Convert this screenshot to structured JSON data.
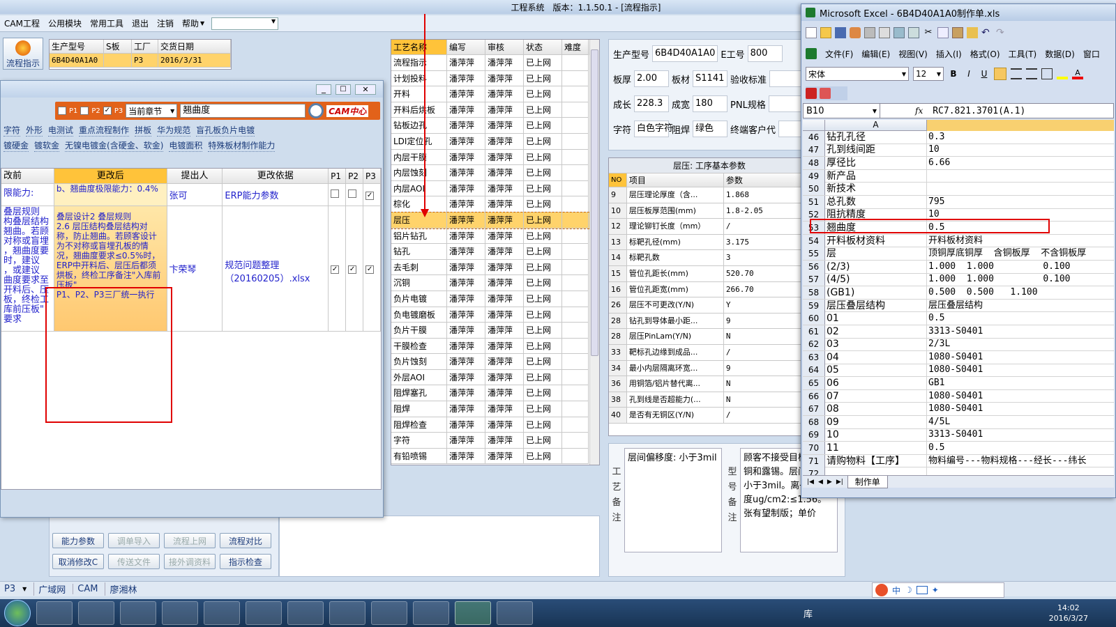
{
  "app": {
    "title": "工程系统　版本：1.1.50.1 - [流程指示]",
    "menu": [
      "CAM工程",
      "公用模块",
      "常用工具",
      "退出",
      "注销",
      "帮助"
    ],
    "process_btn": "流程指示"
  },
  "order": {
    "headers": [
      "生产型号",
      "S板",
      "工厂",
      "交货日期"
    ],
    "row": [
      "6B4D40A1A0",
      "",
      "P3",
      "2016/3/31"
    ]
  },
  "change": {
    "filters": {
      "p1": "P1",
      "p2": "P2",
      "p3": "P3",
      "chapter": "当前章节",
      "search": "翘曲度",
      "logo": "CAM中心"
    },
    "tags1": [
      "字符",
      "外形",
      "电测试",
      "重点流程制作",
      "拼板",
      "华为规范",
      "盲孔板负片电镀"
    ],
    "tags2": [
      "镀硬金",
      "镀软金",
      "无镍电镀金(含硬金、软金)",
      "电镀面积",
      "特殊板材制作能力"
    ],
    "headers": [
      "改前",
      "更改后",
      "提出人",
      "更改依据",
      "P1",
      "P2",
      "P3"
    ],
    "rows": [
      {
        "before": "限能力:",
        "after": "b、翘曲度极限能力：0.4%",
        "by": "张可",
        "basis": "ERP能力参数",
        "p1": "",
        "p2": "",
        "p3": "✓"
      },
      {
        "before": "叠层规则\n构叠层结构\n翘曲。若顾\n对称或盲埋\n，翘曲度要\n时，建议\n，或建议\n曲度要求至\n开料后、压\n板，终检工\n库前压板\"\n要求",
        "after": "叠层设计2 叠层规则\n2.6 层压结构叠层结构对称，防止翘曲。若顾客设计为不对称或盲埋孔板的情况，翘曲度要求≤0.5%时，ERP中开料后、层压后都须烘板，终检工序备注\"入库前压板\"\nP1、P2、P3三厂统一执行",
        "by": "卞荣琴",
        "basis": "规范问题整理（20160205）.xlsx",
        "p1": "✓",
        "p2": "✓",
        "p3": "✓"
      }
    ]
  },
  "buttons": [
    [
      "能力参数",
      "调单导入",
      "流程上网",
      "流程对比"
    ],
    [
      "取消修改C",
      "传送文件",
      "接外调资料",
      "指示检查"
    ]
  ],
  "process": {
    "headers": [
      "工艺名称",
      "编写",
      "审核",
      "状态",
      "难度"
    ],
    "rows": [
      [
        "流程指示",
        "潘萍萍",
        "潘萍萍",
        "已上网"
      ],
      [
        "计划投料",
        "潘萍萍",
        "潘萍萍",
        "已上网"
      ],
      [
        "开料",
        "潘萍萍",
        "潘萍萍",
        "已上网"
      ],
      [
        "开料后烘板",
        "潘萍萍",
        "潘萍萍",
        "已上网"
      ],
      [
        "钻板边孔",
        "潘萍萍",
        "潘萍萍",
        "已上网"
      ],
      [
        "LDI定位孔",
        "潘萍萍",
        "潘萍萍",
        "已上网"
      ],
      [
        "内层干膜",
        "潘萍萍",
        "潘萍萍",
        "已上网"
      ],
      [
        "内层蚀刻",
        "潘萍萍",
        "潘萍萍",
        "已上网"
      ],
      [
        "内层AOI",
        "潘萍萍",
        "潘萍萍",
        "已上网"
      ],
      [
        "棕化",
        "潘萍萍",
        "潘萍萍",
        "已上网"
      ],
      [
        "层压",
        "潘萍萍",
        "潘萍萍",
        "已上网"
      ],
      [
        "铝片钻孔",
        "潘萍萍",
        "潘萍萍",
        "已上网"
      ],
      [
        "钻孔",
        "潘萍萍",
        "潘萍萍",
        "已上网"
      ],
      [
        "去毛刺",
        "潘萍萍",
        "潘萍萍",
        "已上网"
      ],
      [
        "沉铜",
        "潘萍萍",
        "潘萍萍",
        "已上网"
      ],
      [
        "负片电镀",
        "潘萍萍",
        "潘萍萍",
        "已上网"
      ],
      [
        "负电镀磨板",
        "潘萍萍",
        "潘萍萍",
        "已上网"
      ],
      [
        "负片干膜",
        "潘萍萍",
        "潘萍萍",
        "已上网"
      ],
      [
        "干膜检查",
        "潘萍萍",
        "潘萍萍",
        "已上网"
      ],
      [
        "负片蚀刻",
        "潘萍萍",
        "潘萍萍",
        "已上网"
      ],
      [
        "外层AOI",
        "潘萍萍",
        "潘萍萍",
        "已上网"
      ],
      [
        "阻焊塞孔",
        "潘萍萍",
        "潘萍萍",
        "已上网"
      ],
      [
        "阻焊",
        "潘萍萍",
        "潘萍萍",
        "已上网"
      ],
      [
        "阻焊检查",
        "潘萍萍",
        "潘萍萍",
        "已上网"
      ],
      [
        "字符",
        "潘萍萍",
        "潘萍萍",
        "已上网"
      ],
      [
        "有铅喷锡",
        "潘萍萍",
        "潘萍萍",
        "已上网"
      ]
    ]
  },
  "info": {
    "rows": [
      [
        [
          "生产型号",
          "6B4D40A1A0"
        ],
        [
          "E工号",
          "800"
        ]
      ],
      [
        [
          "板厚",
          "2.00"
        ],
        [
          "板材",
          "S1141"
        ],
        [
          "验收标准",
          ""
        ]
      ],
      [
        [
          "成长",
          "228.3"
        ],
        [
          "成宽",
          "180"
        ],
        [
          "PNL规格",
          ""
        ]
      ],
      [
        [
          "字符",
          "白色字符"
        ],
        [
          "阻焊",
          "绿色"
        ],
        [
          "终端客户代",
          ""
        ]
      ]
    ]
  },
  "params": {
    "title": "层压: 工序基本参数",
    "headers": [
      "NO",
      "项目",
      "参数"
    ],
    "rows": [
      [
        "9",
        "层压理论厚度（含...",
        "1.868"
      ],
      [
        "10",
        "层压板厚范围(mm)",
        "1.8-2.05"
      ],
      [
        "12",
        "理论铆钉长度（mm）",
        "/"
      ],
      [
        "13",
        "标靶孔径(mm)",
        "3.175"
      ],
      [
        "14",
        "标靶孔数",
        "3"
      ],
      [
        "15",
        "管位孔距长(mm)",
        "520.70"
      ],
      [
        "16",
        "管位孔距宽(mm)",
        "266.70"
      ],
      [
        "26",
        "层压不可更改(Y/N)",
        "Y"
      ],
      [
        "28",
        "钻孔到导体最小距...",
        "9"
      ],
      [
        "28",
        "层压PinLam(Y/N)",
        "N"
      ],
      [
        "33",
        "靶标孔边缘到成品...",
        "/"
      ],
      [
        "34",
        "最小内层隔离环宽...",
        "9"
      ],
      [
        "36",
        "用铜箔/铝片替代离...",
        "N"
      ],
      [
        "38",
        "孔到线是否超能力(...",
        "N"
      ],
      [
        "40",
        "是否有无铜区(Y/N)",
        "/"
      ]
    ]
  },
  "notes": {
    "process_label": "工艺备注",
    "process_text": "层间偏移度: 小于3mil",
    "model_label": "型号备注",
    "model_text": "顾客不接受目检假性露铜和露锡。层间偏移度小于3mil。离子污染度ug/cm2:≤1.56。张有望制版；单价"
  },
  "excel": {
    "title": "Microsoft Excel - 6B4D40A1A0制作单.xls",
    "menu": [
      "文件(F)",
      "编辑(E)",
      "视图(V)",
      "插入(I)",
      "格式(O)",
      "工具(T)",
      "数据(D)",
      "窗口"
    ],
    "font": "宋体",
    "size": "12",
    "cellref": "B10",
    "fx": "fx",
    "formula": "RC7.821.3701(A.1)",
    "colA": "A",
    "sheet": "制作单",
    "rows": [
      [
        "46",
        "钻孔孔径",
        "0.3"
      ],
      [
        "47",
        "孔到线间距",
        "10"
      ],
      [
        "48",
        "厚径比",
        "6.66"
      ],
      [
        "49",
        "新产品",
        ""
      ],
      [
        "50",
        "新技术",
        ""
      ],
      [
        "51",
        "总孔数",
        "795"
      ],
      [
        "52",
        "阻抗精度",
        "10"
      ],
      [
        "53",
        "翘曲度",
        "0.5"
      ],
      [
        "54",
        "开料板材资料",
        "开料板材资料"
      ],
      [
        "55",
        "层",
        "顶铜厚底铜厚  含铜板厚  不含铜板厚"
      ],
      [
        "56",
        "(2/3)",
        "1.000  1.000         0.100"
      ],
      [
        "57",
        "(4/5)",
        "1.000  1.000         0.100"
      ],
      [
        "58",
        "(GB1)",
        "0.500  0.500   1.100"
      ],
      [
        "59",
        "层压叠层结构",
        "层压叠层结构"
      ],
      [
        "60",
        "01",
        "0.5"
      ],
      [
        "61",
        "02",
        "3313-S0401"
      ],
      [
        "62",
        "03",
        "2/3L"
      ],
      [
        "63",
        "04",
        "1080-S0401"
      ],
      [
        "64",
        "05",
        "1080-S0401"
      ],
      [
        "65",
        "06",
        "GB1"
      ],
      [
        "66",
        "07",
        "1080-S0401"
      ],
      [
        "67",
        "08",
        "1080-S0401"
      ],
      [
        "68",
        "09",
        "4/5L"
      ],
      [
        "69",
        "10",
        "3313-S0401"
      ],
      [
        "70",
        "11",
        "0.5"
      ],
      [
        "71",
        "请购物料【工序】",
        "物料编号---物料规格---经长---纬长"
      ],
      [
        "72",
        "",
        ""
      ]
    ]
  },
  "statusbar": [
    "P3",
    "广域网",
    "CAM",
    "廖湘林"
  ],
  "tray": {
    "input": "库",
    "time": "14:02",
    "date": "2016/3/27"
  }
}
